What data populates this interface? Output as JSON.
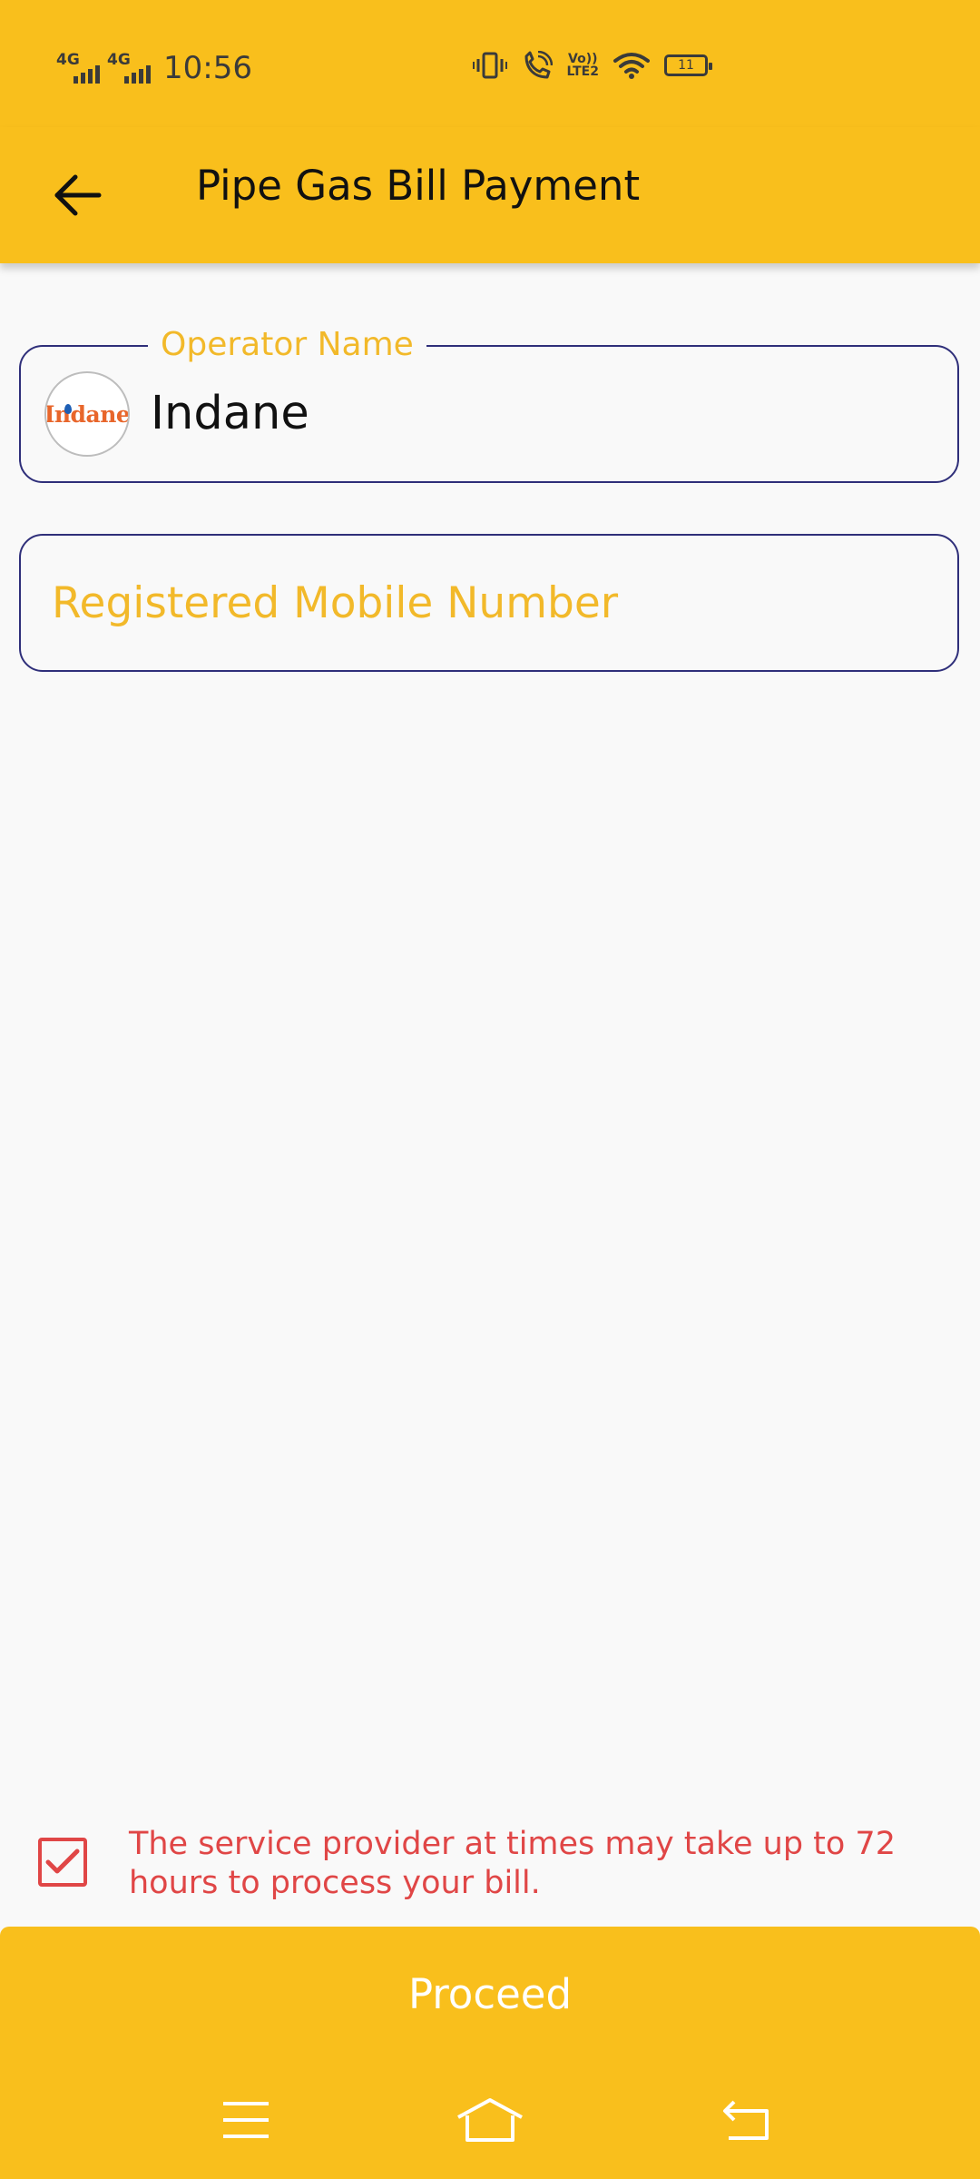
{
  "status_bar": {
    "network_1": "4G",
    "network_2": "4G",
    "time": "10:56",
    "volte_line1": "Vo))",
    "volte_line2": "LTE2",
    "battery_level": "11",
    "icons": [
      "vibrate-icon",
      "wifi-calling-icon",
      "volte-icon",
      "wifi-icon",
      "battery-icon"
    ]
  },
  "app_bar": {
    "back_icon": "arrow-left-icon",
    "title": "Pipe Gas Bill Payment"
  },
  "form": {
    "operator": {
      "label": "Operator Name",
      "value": "Indane",
      "logo_text": "Indane"
    },
    "mobile": {
      "placeholder": "Registered Mobile Number",
      "value": ""
    }
  },
  "notice": {
    "checked": true,
    "text": "The service provider at times may take up to 72 hours to process your bill."
  },
  "actions": {
    "proceed_label": "Proceed"
  },
  "nav_bar": {
    "icons": [
      "menu-icon",
      "home-icon",
      "back-icon"
    ]
  },
  "colors": {
    "accent": "#f9bf1c",
    "label": "#f2b92a",
    "field_border": "#2f2f7a",
    "notice_text": "#e04646",
    "background": "#f9f9f9"
  }
}
